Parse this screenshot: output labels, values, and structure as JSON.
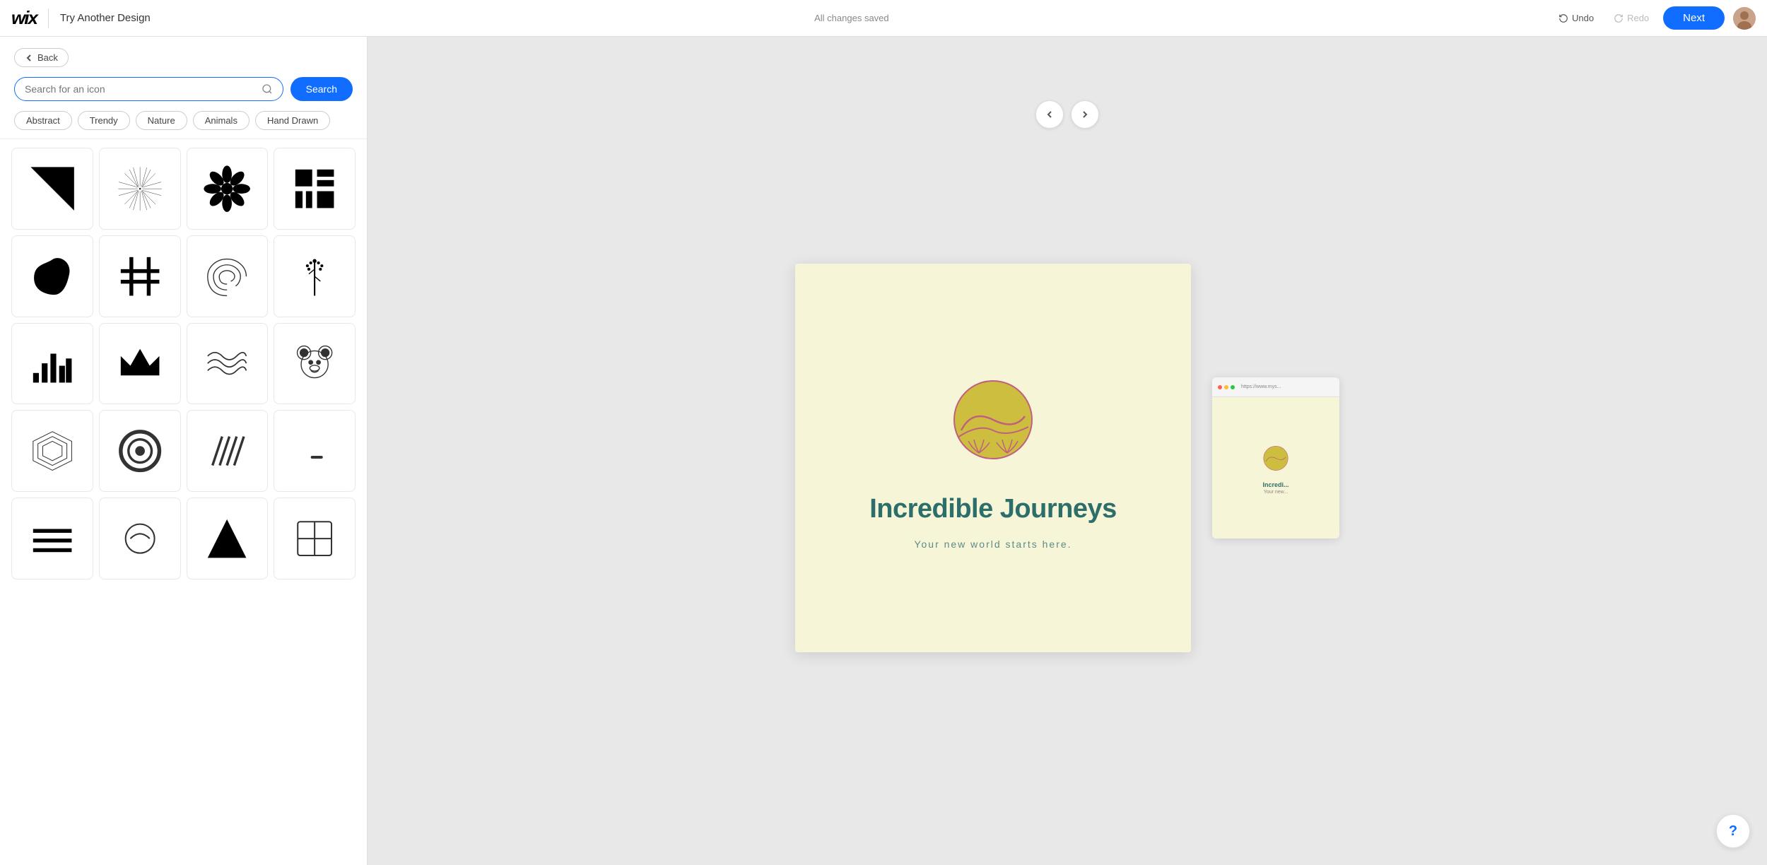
{
  "topbar": {
    "wix_logo": "wix",
    "design_label": "Try Another Design",
    "status": "All changes saved",
    "undo_label": "Undo",
    "redo_label": "Redo",
    "next_label": "Next"
  },
  "left_panel": {
    "back_label": "Back",
    "search_placeholder": "Search for an icon",
    "search_button_label": "Search",
    "tags": [
      "Abstract",
      "Trendy",
      "Nature",
      "Animals",
      "Hand Drawn"
    ]
  },
  "logo": {
    "main_text": "Incredible Journeys",
    "sub_text": "Your new world starts here."
  },
  "help_label": "?"
}
